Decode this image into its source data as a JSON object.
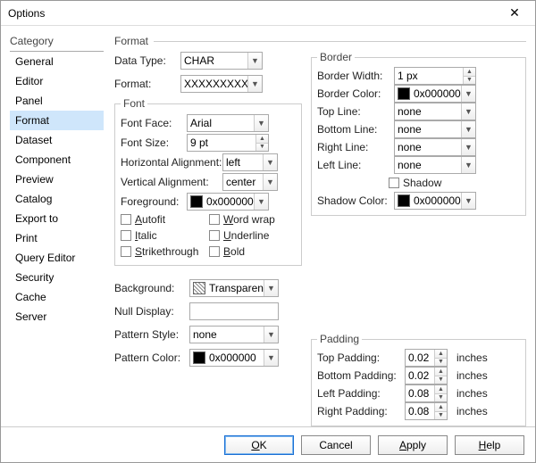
{
  "window": {
    "title": "Options"
  },
  "category": {
    "label": "Category",
    "items": [
      "General",
      "Editor",
      "Panel",
      "Format",
      "Dataset",
      "Component",
      "Preview",
      "Catalog",
      "Export to",
      "Print",
      "Query Editor",
      "Security",
      "Cache",
      "Server"
    ],
    "selected": "Format"
  },
  "format": {
    "label": "Format",
    "dataType": {
      "label": "Data Type:",
      "value": "CHAR"
    },
    "formatStr": {
      "label": "Format:",
      "value": "XXXXXXXXX..."
    },
    "font": {
      "legend": "Font",
      "face": {
        "label": "Font Face:",
        "value": "Arial"
      },
      "size": {
        "label": "Font Size:",
        "value": "9 pt"
      },
      "halign": {
        "label": "Horizontal Alignment:",
        "value": "left"
      },
      "valign": {
        "label": "Vertical Alignment:",
        "value": "center"
      },
      "fg": {
        "label": "Foreground:",
        "value": "0x000000"
      },
      "checks": {
        "autofit": "Autofit",
        "italic": "Italic",
        "strike": "Strikethrough",
        "wrap": "Word wrap",
        "underline": "Underline",
        "bold": "Bold"
      }
    },
    "bg": {
      "label": "Background:",
      "value": "Transparent"
    },
    "nulldisp": {
      "label": "Null Display:",
      "value": ""
    },
    "pstyle": {
      "label": "Pattern Style:",
      "value": "none"
    },
    "pcolor": {
      "label": "Pattern Color:",
      "value": "0x000000"
    }
  },
  "border": {
    "legend": "Border",
    "width": {
      "label": "Border Width:",
      "value": "1 px"
    },
    "color": {
      "label": "Border Color:",
      "value": "0x000000"
    },
    "top": {
      "label": "Top Line:",
      "value": "none"
    },
    "bottom": {
      "label": "Bottom Line:",
      "value": "none"
    },
    "right": {
      "label": "Right Line:",
      "value": "none"
    },
    "left": {
      "label": "Left Line:",
      "value": "none"
    },
    "shadow": {
      "label": "Shadow"
    },
    "shadowColor": {
      "label": "Shadow Color:",
      "value": "0x000000"
    }
  },
  "padding": {
    "legend": "Padding",
    "unit": "inches",
    "top": {
      "label": "Top Padding:",
      "value": "0.02"
    },
    "bottom": {
      "label": "Bottom Padding:",
      "value": "0.02"
    },
    "left": {
      "label": "Left Padding:",
      "value": "0.08"
    },
    "right": {
      "label": "Right Padding:",
      "value": "0.08"
    }
  },
  "buttons": {
    "ok": "OK",
    "cancel": "Cancel",
    "apply": "Apply",
    "help": "Help"
  }
}
